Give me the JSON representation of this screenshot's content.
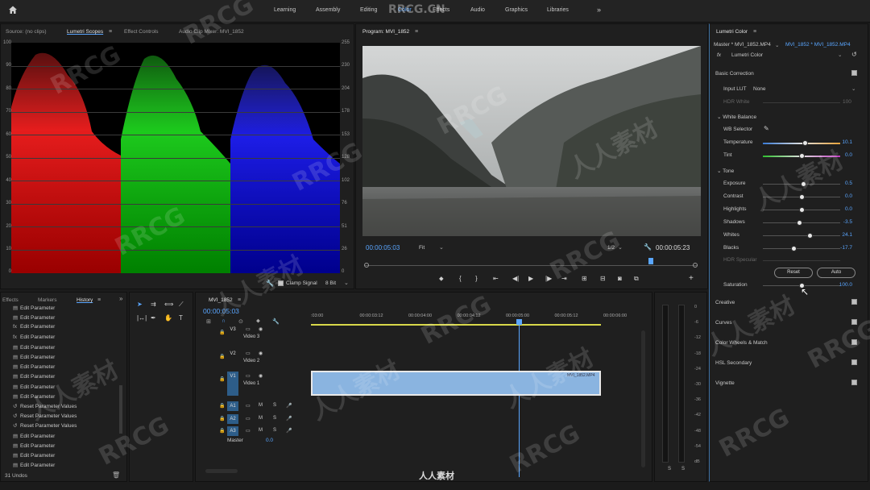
{
  "header": {
    "workspaces": [
      "Learning",
      "Assembly",
      "Editing",
      "Color",
      "Effects",
      "Audio",
      "Graphics",
      "Libraries"
    ],
    "active_workspace": "Color",
    "more": "»"
  },
  "source_panel": {
    "tabs": [
      "Source: (no clips)",
      "Lumetri Scopes",
      "Effect Controls",
      "Audio Clip Mixer: MVI_1852"
    ],
    "active_tab": "Lumetri Scopes",
    "left_ticks": [
      "100",
      "90",
      "80",
      "70",
      "60",
      "50",
      "40",
      "30",
      "20",
      "10",
      "0"
    ],
    "right_ticks": [
      "255",
      "230",
      "204",
      "178",
      "153",
      "128",
      "102",
      "76",
      "51",
      "26",
      "0"
    ],
    "clamp_signal": "Clamp Signal",
    "bit_depth": "8 Bit"
  },
  "program": {
    "title": "Program: MVI_1852",
    "timecode_left": "00:00:05:03",
    "fit": "Fit",
    "resolution": "1/2",
    "timecode_right": "00:00:05:23"
  },
  "history_panel": {
    "tabs": [
      "Effects",
      "Markers",
      "History"
    ],
    "active_tab": "History",
    "items": [
      {
        "icon": "param",
        "label": "Edit Parameter"
      },
      {
        "icon": "param",
        "label": "Edit Parameter"
      },
      {
        "icon": "fx",
        "label": "Edit Parameter"
      },
      {
        "icon": "fx",
        "label": "Edit Parameter"
      },
      {
        "icon": "param",
        "label": "Edit Parameter"
      },
      {
        "icon": "param",
        "label": "Edit Parameter"
      },
      {
        "icon": "param",
        "label": "Edit Parameter"
      },
      {
        "icon": "param",
        "label": "Edit Parameter"
      },
      {
        "icon": "param",
        "label": "Edit Parameter"
      },
      {
        "icon": "param",
        "label": "Edit Parameter"
      },
      {
        "icon": "reset",
        "label": "Reset Parameter Values"
      },
      {
        "icon": "reset",
        "label": "Reset Parameter Values"
      },
      {
        "icon": "reset",
        "label": "Reset Parameter Values"
      },
      {
        "icon": "param",
        "label": "Edit Parameter"
      },
      {
        "icon": "param",
        "label": "Edit Parameter"
      },
      {
        "icon": "param",
        "label": "Edit Parameter"
      },
      {
        "icon": "param",
        "label": "Edit Parameter"
      }
    ],
    "footer": "31 Undos"
  },
  "timeline": {
    "sequence": "MVI_1852",
    "timecode": "00:00:05:03",
    "ruler": [
      ":03:00",
      "00:00:03:12",
      "00:00:04:00",
      "00:00:04:12",
      "00:00:05:00",
      "00:00:05:12",
      "00:00:06:00"
    ],
    "video_tracks": [
      {
        "id": "V3",
        "name": "Video 3"
      },
      {
        "id": "V2",
        "name": "Video 2"
      },
      {
        "id": "V1",
        "name": "Video 1"
      }
    ],
    "audio_tracks": [
      "A1",
      "A2",
      "A3"
    ],
    "master_label": "Master",
    "master_value": "0.0",
    "clip_name": "MVI_1852.MP4"
  },
  "audio_meter": {
    "ticks": [
      "0",
      "-6",
      "-12",
      "-18",
      "-24",
      "-30",
      "-36",
      "-42",
      "-48",
      "-54",
      "dB"
    ],
    "solo": [
      "S",
      "S"
    ]
  },
  "lumetri": {
    "title": "Lumetri Color",
    "master_path": "Master * MVI_1852.MP4",
    "clip_path": "MVI_1852 * MVI_1852.MP4",
    "effect_name": "Lumetri Color",
    "sections": {
      "basic_correction": "Basic Correction",
      "input_lut_label": "Input LUT",
      "input_lut_value": "None",
      "hdr_white_label": "HDR White",
      "hdr_white_value": "100",
      "white_balance": "White Balance",
      "wb_selector": "WB Selector",
      "tone": "Tone",
      "hdr_specular": "HDR Specular",
      "reset": "Reset",
      "auto": "Auto",
      "creative": "Creative",
      "curves": "Curves",
      "color_wheels": "Color Wheels & Match",
      "hsl": "HSL Secondary",
      "vignette": "Vignette"
    },
    "white_balance": [
      {
        "label": "Temperature",
        "value": "10.1",
        "pos": 0.55
      },
      {
        "label": "Tint",
        "value": "0.0",
        "pos": 0.5
      }
    ],
    "tone": [
      {
        "label": "Exposure",
        "value": "0.5",
        "pos": 0.53
      },
      {
        "label": "Contrast",
        "value": "0.0",
        "pos": 0.5
      },
      {
        "label": "Highlights",
        "value": "0.0",
        "pos": 0.5
      },
      {
        "label": "Shadows",
        "value": "-3.5",
        "pos": 0.47
      },
      {
        "label": "Whites",
        "value": "24.1",
        "pos": 0.61
      },
      {
        "label": "Blacks",
        "value": "-17.7",
        "pos": 0.4
      }
    ],
    "saturation": {
      "label": "Saturation",
      "value": "100.0",
      "pos": 0.5
    }
  },
  "footer_logo": "人人素材",
  "watermarks": [
    "RRCG",
    "人人素材",
    "RRCG.CN"
  ],
  "colors": {
    "accent": "#5aa6ff",
    "clip": "#8ab4e0",
    "track_id": "#2d5d89"
  }
}
